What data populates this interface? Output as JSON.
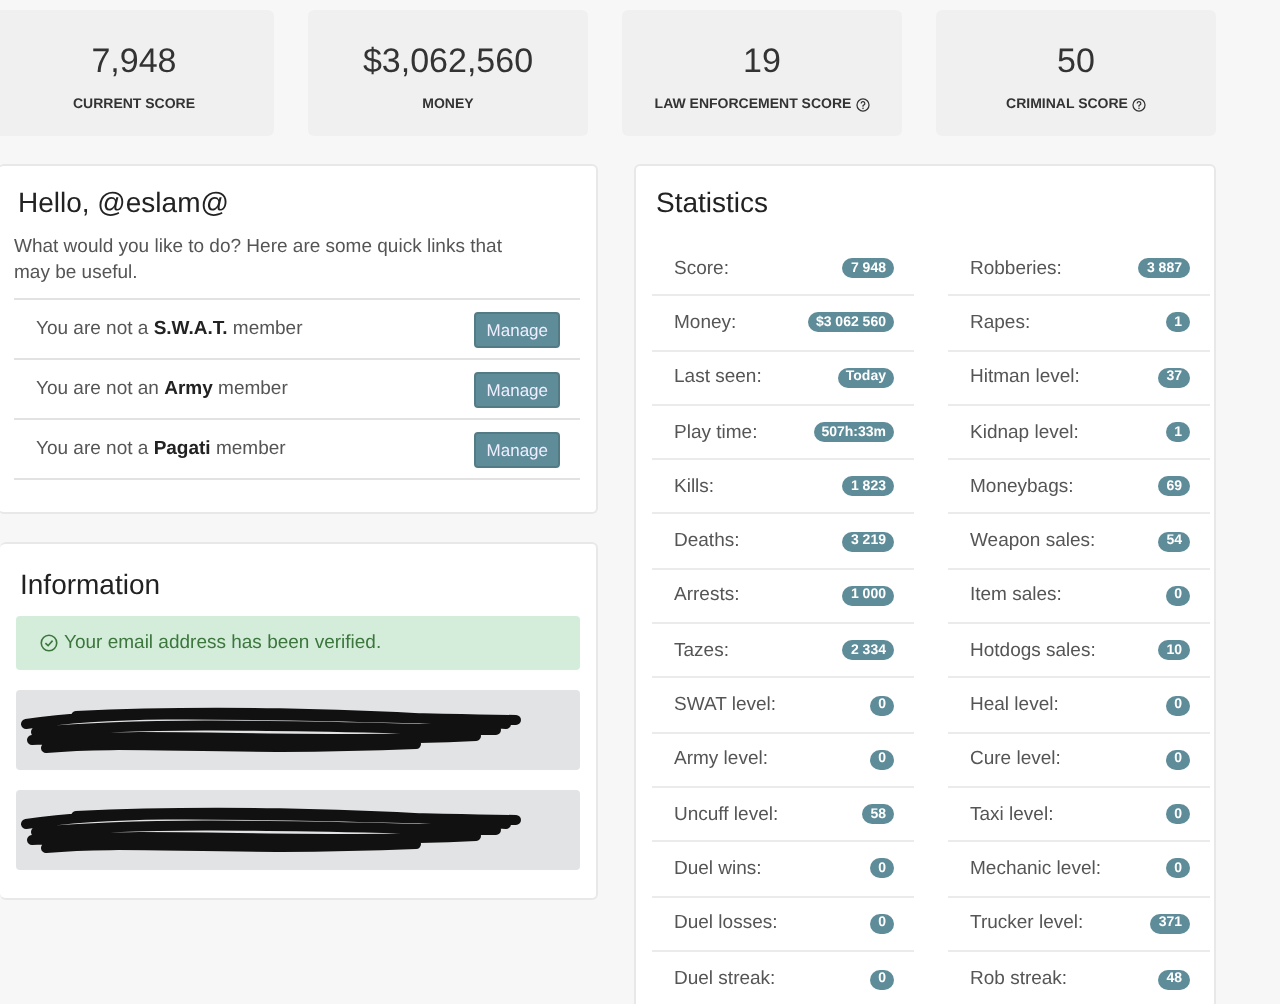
{
  "summary_cards": [
    {
      "value": "7,948",
      "label": "CURRENT SCORE",
      "help": false
    },
    {
      "value": "$3,062,560",
      "label": "MONEY",
      "help": false
    },
    {
      "value": "19",
      "label": "LAW ENFORCEMENT SCORE",
      "help": true
    },
    {
      "value": "50",
      "label": "CRIMINAL SCORE",
      "help": true
    }
  ],
  "welcome": {
    "title": "Hello, @eslam@",
    "intro": "What would you like to do? Here are some quick links that may be useful.",
    "memberships": [
      {
        "text": "You are not a **S.W.A.T.** member",
        "button": "Manage"
      },
      {
        "text": "You are not an **Army** member",
        "button": "Manage"
      },
      {
        "text": "You are not a **Pagati** member",
        "button": "Manage"
      }
    ]
  },
  "information": {
    "title": "Information",
    "alert": "Your email address has been verified.",
    "fields": [
      {
        "kind": "redacted"
      },
      {
        "kind": "redacted"
      }
    ]
  },
  "statistics": {
    "title": "Statistics",
    "columns": [
      [
        {
          "label": "Score:",
          "value": "7 948"
        },
        {
          "label": "Money:",
          "value": "$3 062 560"
        },
        {
          "label": "Last seen:",
          "value": "Today"
        },
        {
          "label": "Play time:",
          "value": "507h:33m"
        },
        {
          "label": "Kills:",
          "value": "1 823"
        },
        {
          "label": "Deaths:",
          "value": "3 219"
        },
        {
          "label": "Arrests:",
          "value": "1 000"
        },
        {
          "label": "Tazes:",
          "value": "2 334"
        },
        {
          "label": "SWAT level:",
          "value": "0"
        },
        {
          "label": "Army level:",
          "value": "0"
        },
        {
          "label": "Uncuff level:",
          "value": "58"
        },
        {
          "label": "Duel wins:",
          "value": "0"
        },
        {
          "label": "Duel losses:",
          "value": "0"
        },
        {
          "label": "Duel streak:",
          "value": "0"
        }
      ],
      [
        {
          "label": "Robberies:",
          "value": "3 887"
        },
        {
          "label": "Rapes:",
          "value": "1"
        },
        {
          "label": "Hitman level:",
          "value": "37"
        },
        {
          "label": "Kidnap level:",
          "value": "1"
        },
        {
          "label": "Moneybags:",
          "value": "69"
        },
        {
          "label": "Weapon sales:",
          "value": "54"
        },
        {
          "label": "Item sales:",
          "value": "0"
        },
        {
          "label": "Hotdogs sales:",
          "value": "10"
        },
        {
          "label": "Heal level:",
          "value": "0"
        },
        {
          "label": "Cure level:",
          "value": "0"
        },
        {
          "label": "Taxi level:",
          "value": "0"
        },
        {
          "label": "Mechanic level:",
          "value": "0"
        },
        {
          "label": "Trucker level:",
          "value": "371"
        },
        {
          "label": "Rob streak:",
          "value": "48"
        }
      ]
    ]
  }
}
